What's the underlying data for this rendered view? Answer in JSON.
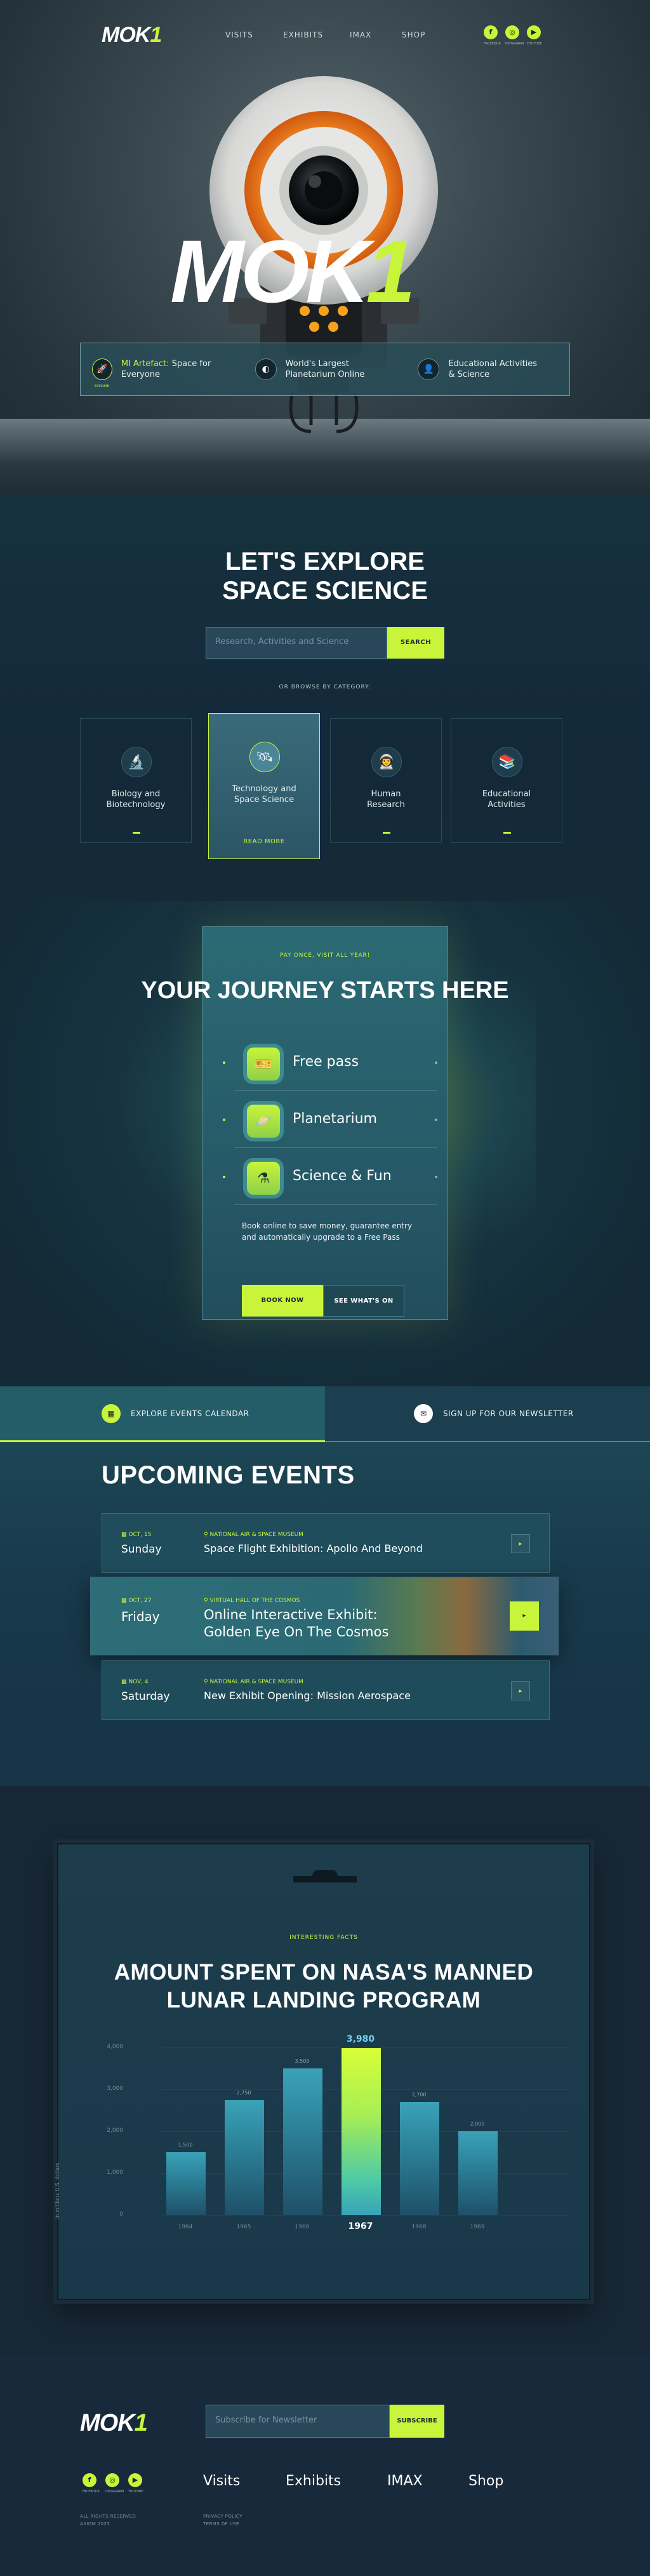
{
  "colors": {
    "accent": "#c8f53a",
    "background": "#12232f",
    "panel": "#245c68"
  },
  "brand": {
    "logo_main": "MOK",
    "logo_one": "1"
  },
  "nav": {
    "items": [
      "VISITS",
      "EXHIBITS",
      "IMAX",
      "SHOP"
    ]
  },
  "social": [
    {
      "icon": "f",
      "label": "FACEBOOK"
    },
    {
      "icon": "◎",
      "label": "INSTAGRAM"
    },
    {
      "icon": "▶",
      "label": "YOUTUBE"
    }
  ],
  "hero": {
    "highlights": [
      {
        "icon": "rocket-icon",
        "text_lime": "MI Artefact:",
        "text": " Space for Everyone",
        "badge": "EXPLORE"
      },
      {
        "icon": "planetarium-icon",
        "text": "World's Largest Planetarium Online"
      },
      {
        "icon": "user-icon",
        "text": "Educational Activities & Science"
      }
    ]
  },
  "explore": {
    "title_line1": "LET'S EXPLORE",
    "title_line2": "SPACE SCIENCE",
    "search_placeholder": "Research, Activities and Science",
    "search_button": "SEARCH",
    "browse_label": "OR BROWSE BY CATEGORY:",
    "categories": [
      {
        "label": "Biology and Biotechnology",
        "icon": "microscope-icon",
        "glyph": "🔬"
      },
      {
        "label": "Technology and Space Science",
        "icon": "satellite-icon",
        "glyph": "🛰",
        "more": "READ MORE"
      },
      {
        "label": "Human Research",
        "icon": "astronaut-icon",
        "glyph": "👨‍🚀"
      },
      {
        "label": "Educational Activities",
        "icon": "book-icon",
        "glyph": "📚"
      }
    ]
  },
  "journey": {
    "tag": "PAY ONCE, VISIT ALL YEAR!",
    "title": "YOUR JOURNEY STARTS HERE",
    "items": [
      {
        "label": "Free pass",
        "icon": "ticket-icon",
        "glyph": "🎫"
      },
      {
        "label": "Planetarium",
        "icon": "planet-icon",
        "glyph": "🪐"
      },
      {
        "label": "Science & Fun",
        "icon": "flask-icon",
        "glyph": "⚗"
      }
    ],
    "description": "Book online to save money, guarantee entry and automatically upgrade to a Free Pass",
    "book_button": "BOOK NOW",
    "whats_on_button": "SEE WHAT'S ON"
  },
  "events": {
    "tab_calendar": "EXPLORE EVENTS CALENDAR",
    "tab_newsletter": "SIGN UP FOR OUR NEWSLETTER",
    "title": "UPCOMING EVENTS",
    "list": [
      {
        "date": "OCT, 15",
        "day": "Sunday",
        "location": "NATIONAL AIR & SPACE MUSEUM",
        "title": "Space Flight Exhibition: Apollo And Beyond"
      },
      {
        "date": "OCT, 27",
        "day": "Friday",
        "location": "VIRTUAL HALL OF THE COSMOS",
        "title": "Online Interactive Exhibit: Golden Eye On The Cosmos"
      },
      {
        "date": "NOV, 4",
        "day": "Saturday",
        "location": "NATIONAL AIR & SPACE MUSEUM",
        "title": "New Exhibit Opening: Mission Aerospace"
      }
    ]
  },
  "facts": {
    "tag": "INTERESTING FACTS",
    "title_line1": "AMOUNT SPENT ON NASA'S MANNED",
    "title_line2": "LUNAR LANDING PROGRAM"
  },
  "chart_data": {
    "type": "bar",
    "title": "AMOUNT SPENT ON NASA'S MANNED LUNAR LANDING PROGRAM",
    "categories": [
      "1964",
      "1965",
      "1966",
      "1967",
      "1968",
      "1969"
    ],
    "values": [
      1500,
      2750,
      3500,
      3980,
      2700,
      2000
    ],
    "value_labels": [
      "1,500",
      "2,750",
      "3,500",
      "3,980",
      "2,700",
      "2,000"
    ],
    "highlight_index": 3,
    "ylabel": "in millions U.S. dollars",
    "yticks": [
      "4,000",
      "3,000",
      "2,000",
      "1,000",
      "0"
    ],
    "ylim": [
      0,
      4000
    ],
    "grid": true
  },
  "footer": {
    "newsletter_placeholder": "Subscribe for Newsletter",
    "subscribe_button": "SUBSCRIBE",
    "nav": [
      "Visits",
      "Exhibits",
      "IMAX",
      "Shop"
    ],
    "copyright_1": "ALL RIGHTS RESERVED",
    "copyright_2": "AXIOM 2023",
    "legal_1": "PRIVACY POLICY",
    "legal_2": "TERMS OF USE"
  }
}
